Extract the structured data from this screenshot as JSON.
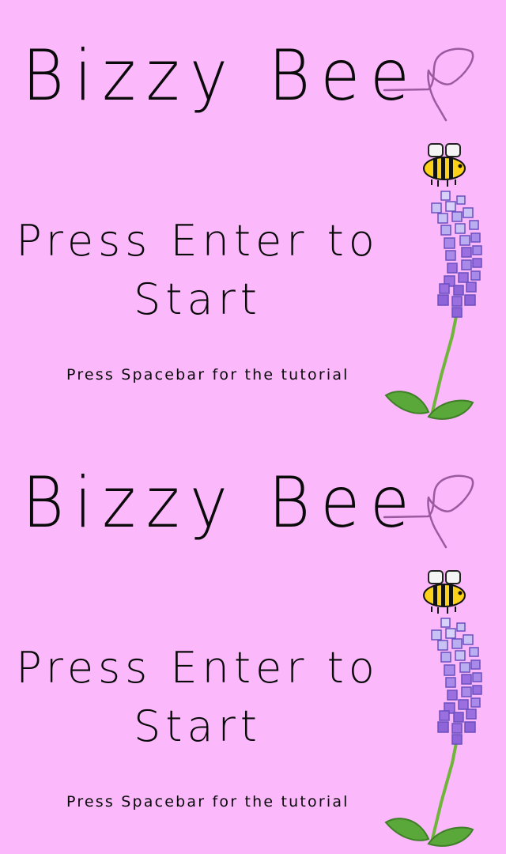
{
  "screens": [
    {
      "title": "Bizzy Bee",
      "start_prompt_line1": "Press Enter to",
      "start_prompt_line2": "Start",
      "tutorial_prompt": "Press Spacebar for the tutorial"
    },
    {
      "title": "Bizzy Bee",
      "start_prompt_line1": "Press Enter to",
      "start_prompt_line2": "Start",
      "tutorial_prompt": "Press Spacebar for the tutorial"
    }
  ],
  "colors": {
    "background": "#fbb8fb",
    "text": "#0a0a0a",
    "bee_yellow": "#ffd21a",
    "bee_stripe": "#111111",
    "wing": "#f4f4f4",
    "flower_light": "#c9c2f5",
    "flower_dark": "#9b6fe0",
    "stem": "#6fb53a",
    "leaf": "#5aa83a",
    "trail": "#9a5aa0"
  },
  "icons": [
    "bee-icon",
    "lupine-flower-icon",
    "flight-trail-icon"
  ]
}
